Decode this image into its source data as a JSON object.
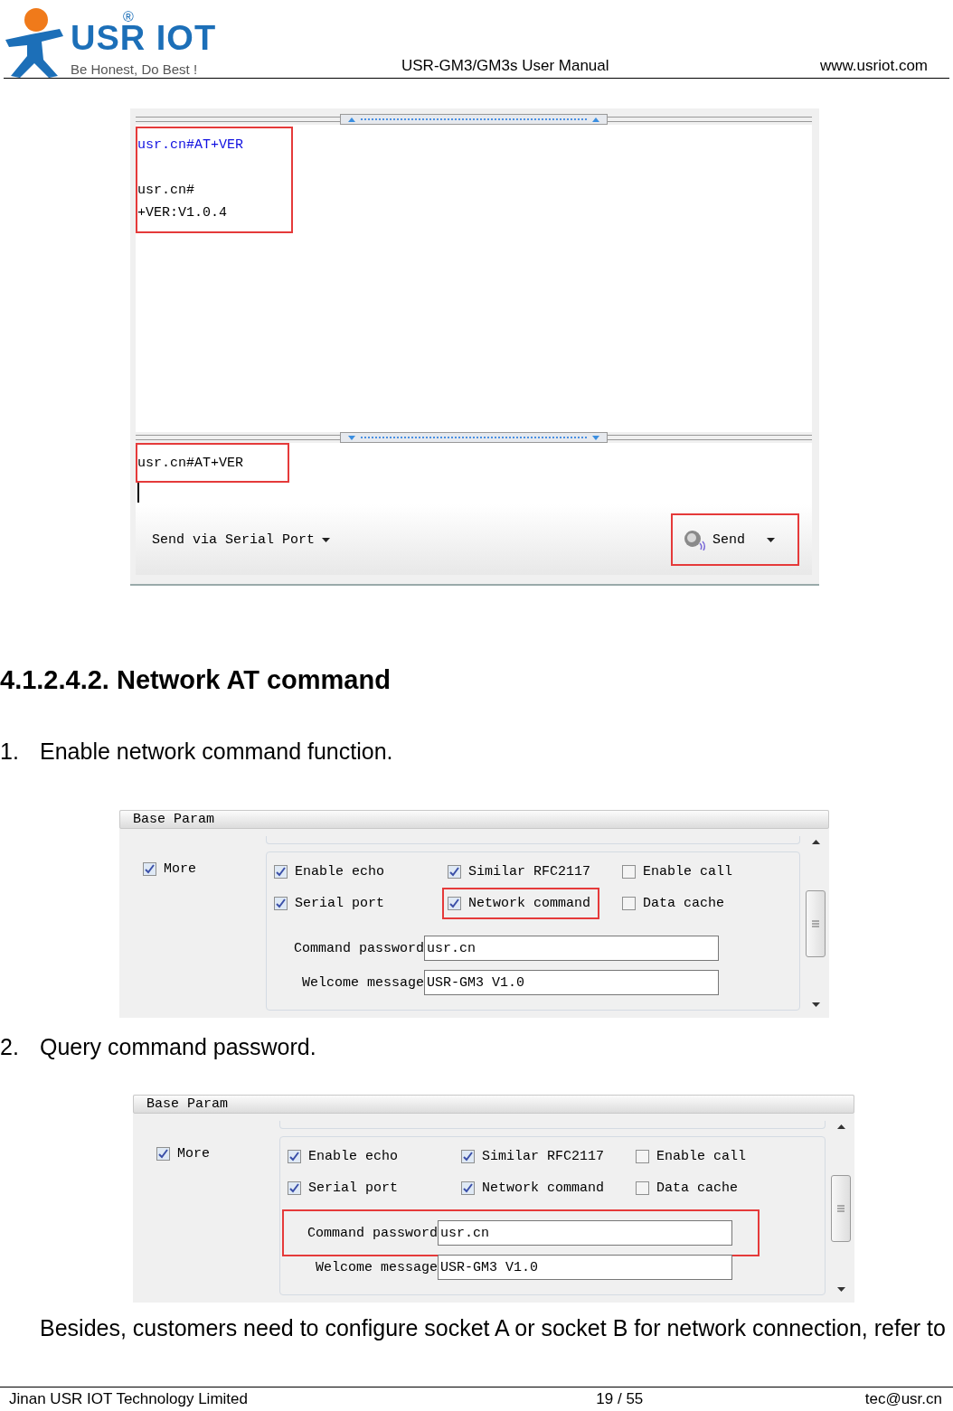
{
  "header": {
    "brand": "USR IOT",
    "registered": "®",
    "tagline": "Be Honest, Do Best !",
    "title": "USR-GM3/GM3s User Manual",
    "website": "www.usriot.com"
  },
  "terminal": {
    "output_highlighted": true,
    "output_lines": [
      {
        "text": "usr.cn#AT+VER",
        "kind": "command"
      },
      {
        "kind": "blank"
      },
      {
        "text": "usr.cn#",
        "kind": "response"
      },
      {
        "text": "+VER:V1.0.4",
        "kind": "response"
      }
    ],
    "input_text": "usr.cn#AT+VER",
    "input_highlighted": true,
    "send_mode": "Send via Serial Port",
    "send_button": "Send",
    "send_highlighted": true
  },
  "heading": "4.1.2.4.2. Network AT command",
  "steps": [
    {
      "number": "1.",
      "text": "Enable network command function."
    },
    {
      "number": "2.",
      "text": "Query command password."
    }
  ],
  "panels": [
    {
      "title": "Base Param",
      "more": {
        "label": "More",
        "checked": true
      },
      "options": [
        {
          "label": "Enable echo",
          "checked": true,
          "highlighted": false
        },
        {
          "label": "Similar RFC2117",
          "checked": true,
          "highlighted": false
        },
        {
          "label": "Enable call",
          "checked": false,
          "highlighted": false
        },
        {
          "label": "Serial port",
          "checked": true,
          "highlighted": false
        },
        {
          "label": "Network command",
          "checked": true,
          "highlighted": true
        },
        {
          "label": "Data cache",
          "checked": false,
          "highlighted": false
        }
      ],
      "fields": [
        {
          "label": "Command password",
          "value": "usr.cn",
          "highlighted": false
        },
        {
          "label": "Welcome message",
          "value": "USR-GM3 V1.0",
          "highlighted": false
        }
      ]
    },
    {
      "title": "Base Param",
      "more": {
        "label": "More",
        "checked": true
      },
      "options": [
        {
          "label": "Enable echo",
          "checked": true,
          "highlighted": false
        },
        {
          "label": "Similar RFC2117",
          "checked": true,
          "highlighted": false
        },
        {
          "label": "Enable call",
          "checked": false,
          "highlighted": false
        },
        {
          "label": "Serial port",
          "checked": true,
          "highlighted": false
        },
        {
          "label": "Network command",
          "checked": true,
          "highlighted": false
        },
        {
          "label": "Data cache",
          "checked": false,
          "highlighted": false
        }
      ],
      "fields": [
        {
          "label": "Command password",
          "value": "usr.cn",
          "highlighted": true
        },
        {
          "label": "Welcome message",
          "value": "USR-GM3 V1.0",
          "highlighted": false
        }
      ]
    }
  ],
  "paragraph": "Besides, customers need to configure socket A or socket B for network connection, refer to",
  "footer": {
    "company": "Jinan USR IOT Technology Limited",
    "page": "19 / 55",
    "email": "tec@usr.cn"
  }
}
